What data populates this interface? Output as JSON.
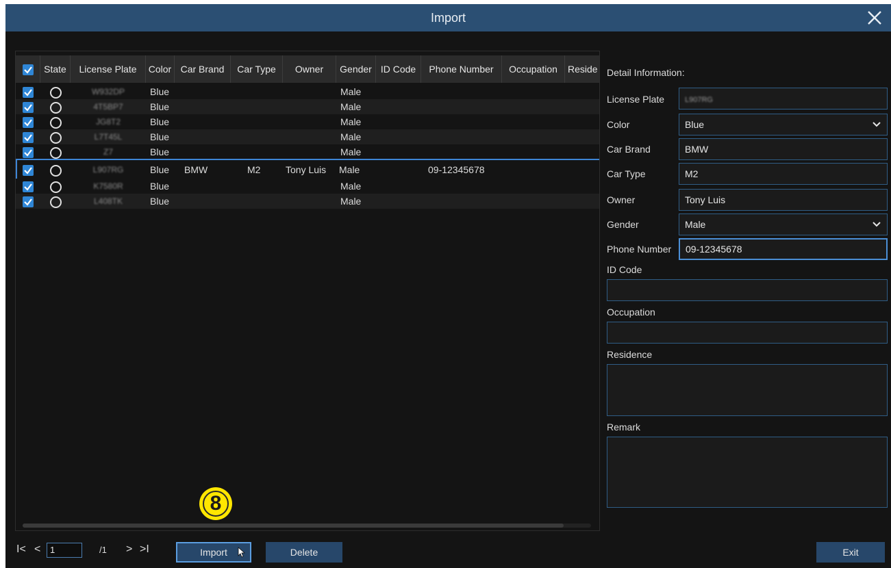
{
  "window": {
    "title": "Import"
  },
  "table": {
    "columns": [
      "State",
      "License Plate",
      "Color",
      "Car Brand",
      "Car Type",
      "Owner",
      "Gender",
      "ID Code",
      "Phone Number",
      "Occupation",
      "Reside"
    ],
    "rows": [
      {
        "plate": "W932DP",
        "color": "Blue",
        "brand": "",
        "type": "",
        "owner": "",
        "gender": "Male",
        "id_code": "",
        "phone": "",
        "occupation": ""
      },
      {
        "plate": "4T5BP7",
        "color": "Blue",
        "brand": "",
        "type": "",
        "owner": "",
        "gender": "Male",
        "id_code": "",
        "phone": "",
        "occupation": ""
      },
      {
        "plate": "JG8T2",
        "color": "Blue",
        "brand": "",
        "type": "",
        "owner": "",
        "gender": "Male",
        "id_code": "",
        "phone": "",
        "occupation": ""
      },
      {
        "plate": "L7T45L",
        "color": "Blue",
        "brand": "",
        "type": "",
        "owner": "",
        "gender": "Male",
        "id_code": "",
        "phone": "",
        "occupation": ""
      },
      {
        "plate": "Z7",
        "color": "Blue",
        "brand": "",
        "type": "",
        "owner": "",
        "gender": "Male",
        "id_code": "",
        "phone": "",
        "occupation": ""
      },
      {
        "plate": "L907RG",
        "color": "Blue",
        "brand": "BMW",
        "type": "M2",
        "owner": "Tony Luis",
        "gender": "Male",
        "id_code": "",
        "phone": "09-12345678",
        "occupation": ""
      },
      {
        "plate": "K7580R",
        "color": "Blue",
        "brand": "",
        "type": "",
        "owner": "",
        "gender": "Male",
        "id_code": "",
        "phone": "",
        "occupation": ""
      },
      {
        "plate": "L408TK",
        "color": "Blue",
        "brand": "",
        "type": "",
        "owner": "",
        "gender": "Male",
        "id_code": "",
        "phone": "",
        "occupation": ""
      }
    ],
    "selected_row": 5
  },
  "detail": {
    "title": "Detail Information:",
    "license_plate_label": "License Plate",
    "license_plate_value": "L907RG",
    "color_label": "Color",
    "color_value": "Blue",
    "car_brand_label": "Car Brand",
    "car_brand_value": "BMW",
    "car_type_label": "Car Type",
    "car_type_value": "M2",
    "owner_label": "Owner",
    "owner_value": "Tony Luis",
    "gender_label": "Gender",
    "gender_value": "Male",
    "phone_label": "Phone Number",
    "phone_value": "09-12345678",
    "id_code_label": "ID Code",
    "id_code_value": "",
    "occupation_label": "Occupation",
    "occupation_value": "",
    "residence_label": "Residence",
    "residence_value": "",
    "remark_label": "Remark",
    "remark_value": ""
  },
  "footer": {
    "page_current": "1",
    "page_total": "/1",
    "first_label": "I<",
    "prev_label": "<",
    "next_label": ">",
    "last_label": ">I",
    "import_label": "Import",
    "delete_label": "Delete",
    "exit_label": "Exit"
  },
  "annotation": {
    "step_marker": "8"
  },
  "colors": {
    "titlebar": "#2b4f73",
    "accent": "#2f86d6",
    "badge": "#ffe600"
  }
}
